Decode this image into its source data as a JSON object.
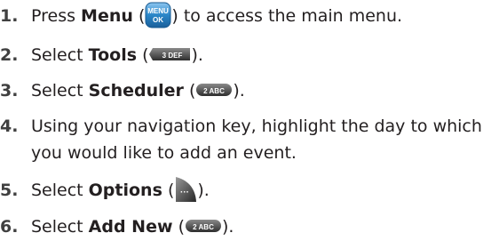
{
  "steps": [
    {
      "number": "1.",
      "before": "Press ",
      "bold": "Menu",
      "after": " to access the main menu.",
      "key": {
        "icon": "menu-ok-key-icon",
        "label_top": "MENU",
        "label_bottom": "OK",
        "color": "#2a86c8"
      }
    },
    {
      "number": "2.",
      "before": "Select ",
      "bold": "Tools",
      "after": ").",
      "key": {
        "icon": "key-3-icon",
        "label": "3 DEF"
      }
    },
    {
      "number": "3.",
      "before": "Select ",
      "bold": "Scheduler",
      "after": ").",
      "key": {
        "icon": "key-2-icon",
        "label": "2 ABC"
      }
    },
    {
      "number": "4.",
      "line1": "Using your navigation key, highlight the day to which",
      "line2": "you would like to add an event."
    },
    {
      "number": "5.",
      "before": "Select ",
      "bold": "Options",
      "after": ").",
      "key": {
        "icon": "options-softkey-icon",
        "label": "···"
      }
    },
    {
      "number": "6.",
      "before": "Select ",
      "bold": "Add New",
      "after": ").",
      "key": {
        "icon": "key-2-icon",
        "label": "2 ABC"
      }
    }
  ]
}
